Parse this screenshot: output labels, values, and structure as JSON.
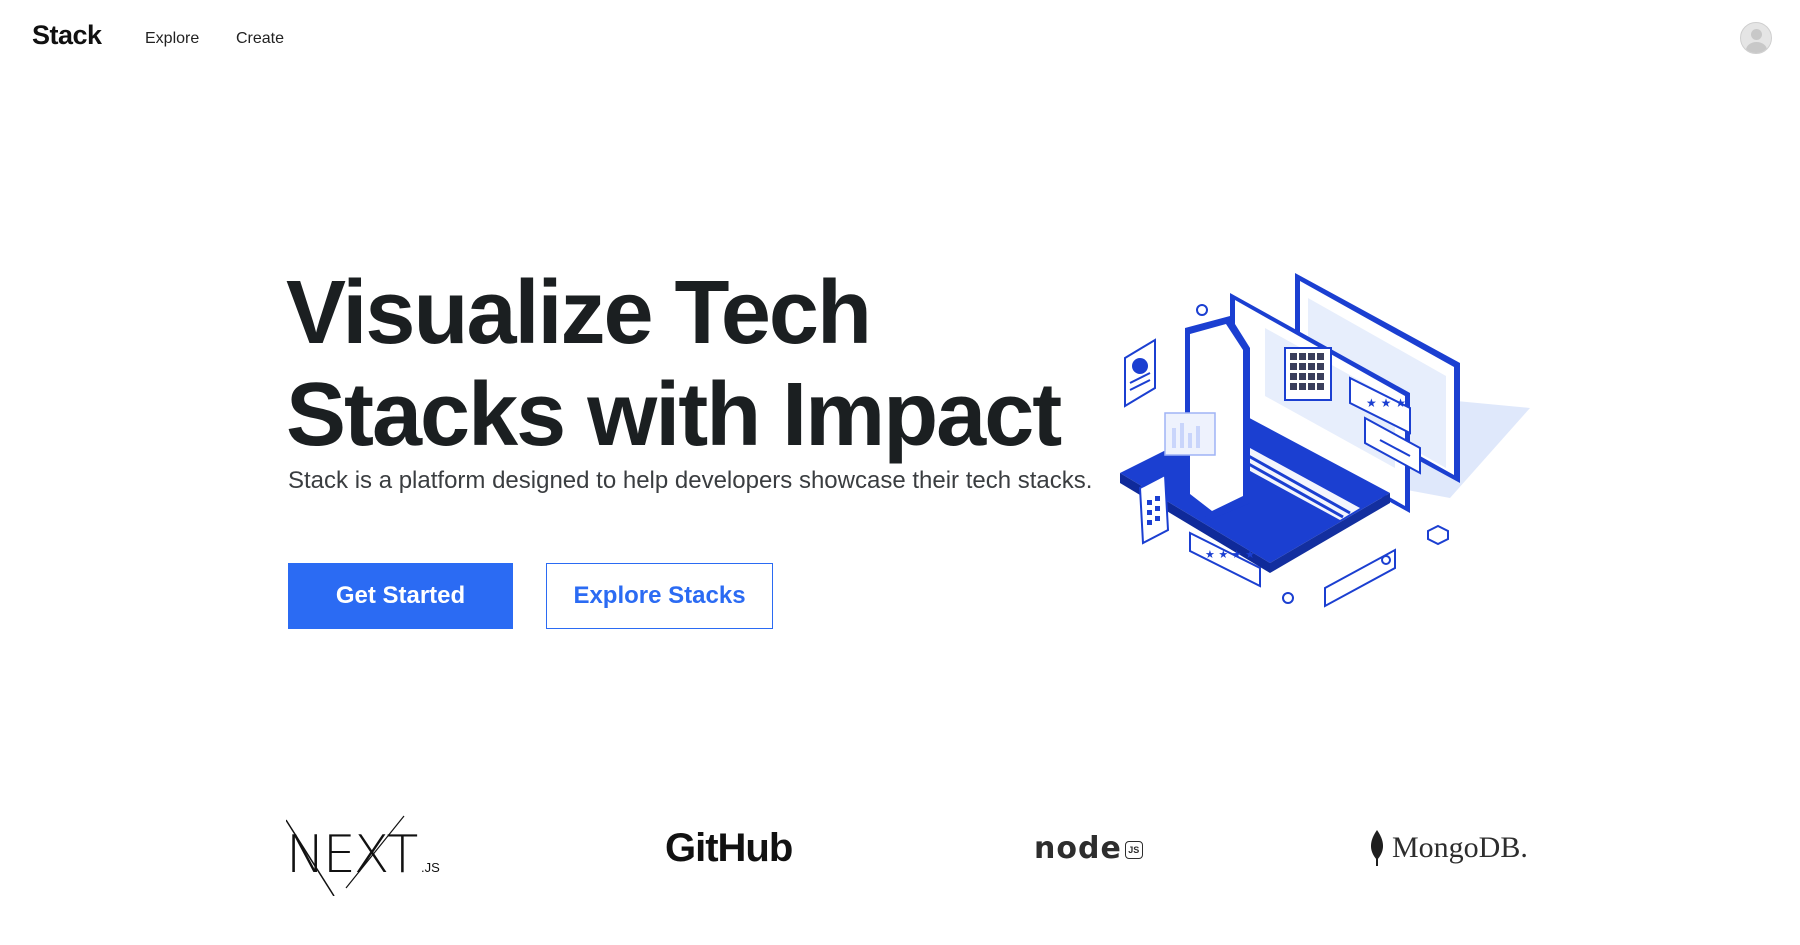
{
  "nav": {
    "brand": "Stack",
    "links": [
      {
        "label": "Explore"
      },
      {
        "label": "Create"
      }
    ]
  },
  "hero": {
    "title_line1": "Visualize Tech",
    "title_line2": "Stacks with Impact",
    "subtitle": "Stack is a platform designed to help developers showcase their tech stacks.",
    "primary_button": "Get Started",
    "secondary_button": "Explore Stacks"
  },
  "logos": {
    "next": {
      "main": "NEXT",
      "suffix": ".JS"
    },
    "github": "GitHub",
    "node": {
      "main": "node",
      "badge": "JS"
    },
    "mongodb": "MongoDB."
  },
  "colors": {
    "accent": "#2b6bf3",
    "illustration_blue": "#1b3fd1",
    "text": "#1b1f21"
  }
}
